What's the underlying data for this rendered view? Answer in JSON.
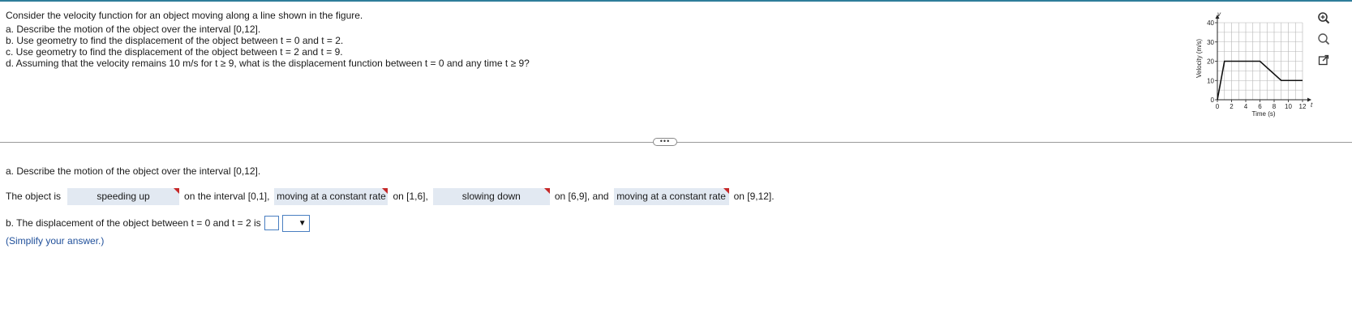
{
  "problem": {
    "intro": "Consider the velocity function for an object moving along a line shown in the figure.",
    "parts": [
      "a. Describe the motion of the object over the interval [0,12].",
      "b. Use geometry to find the displacement of the object between t = 0 and t = 2.",
      "c. Use geometry to find the displacement of the object between t = 2 and t = 9.",
      "d. Assuming that the velocity remains 10 m/s for t ≥ 9, what is the displacement function between t = 0 and any time t ≥ 9?"
    ]
  },
  "figure": {
    "y_axis_letter": "v",
    "x_axis_letter": "t",
    "ylabel": "Velocity (m/s)",
    "xlabel": "Time (s)",
    "y_ticks": [
      "0",
      "10",
      "20",
      "30",
      "40"
    ],
    "x_ticks": [
      "0",
      "2",
      "4",
      "6",
      "8",
      "10",
      "12"
    ]
  },
  "chart_data": {
    "type": "line",
    "x": [
      0,
      1,
      6,
      9,
      12
    ],
    "y": [
      0,
      20,
      20,
      10,
      10
    ],
    "xlabel": "Time (s)",
    "ylabel": "Velocity (m/s)",
    "xlim": [
      0,
      12
    ],
    "ylim": [
      0,
      40
    ],
    "x_ticks": [
      0,
      2,
      4,
      6,
      8,
      10,
      12
    ],
    "y_ticks": [
      0,
      10,
      20,
      30,
      40
    ],
    "grid": true
  },
  "tools": [
    "zoom-in-icon",
    "magnifier-icon",
    "popout-icon"
  ],
  "more_label": "•••",
  "answer": {
    "part_a_title": "a. Describe the motion of the object over the interval [0,12].",
    "prefix": "The object is",
    "choice1": "speeding up",
    "text1": "on the interval [0,1],",
    "choice2": "moving at a constant rate",
    "text2": "on [1,6],",
    "choice3": "slowing down",
    "text3": "on [6,9], and",
    "choice4": "moving at a constant rate",
    "text4": "on [9,12].",
    "part_b": "b. The displacement of the object between t = 0 and t = 2 is",
    "unit_arrow": "▼",
    "hint": "(Simplify your answer.)"
  },
  "colors": {
    "flag": "#c62828",
    "dropdown_bg": "#e2e9f2",
    "hint": "#1f4f9a",
    "accent": "#2e7d9a"
  }
}
